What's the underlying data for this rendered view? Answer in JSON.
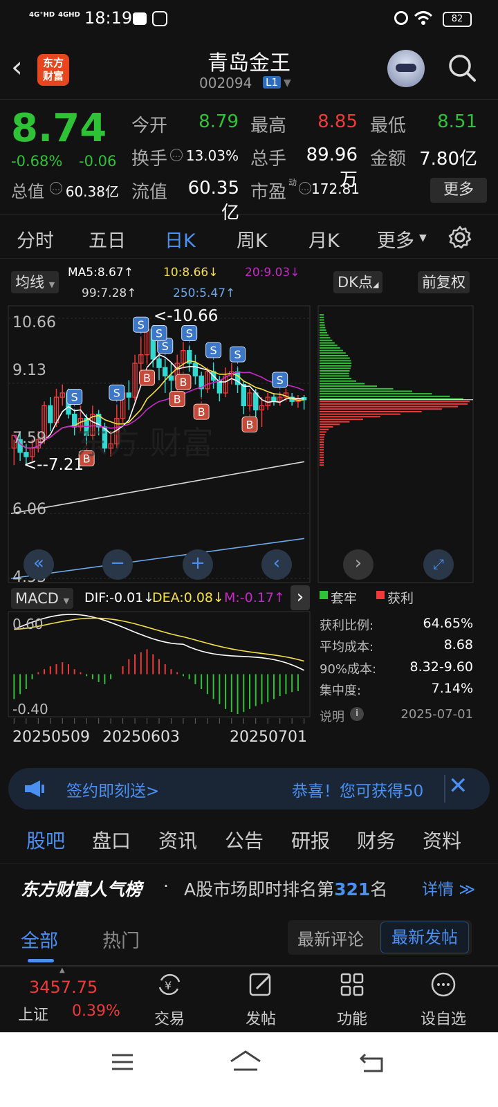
{
  "status_bar": {
    "net1": "4G⁺HD",
    "net2": "4GHD",
    "time": "18:19",
    "battery": "82"
  },
  "header": {
    "logo": "东方\n财富",
    "title": "青岛金王",
    "code": "002094",
    "level": "L1"
  },
  "quote": {
    "price": "8.74",
    "change_pct": "-0.68%",
    "change": "-0.06",
    "open_label": "今开",
    "open": "8.79",
    "high_label": "最高",
    "high": "8.85",
    "low_label": "最低",
    "low": "8.51",
    "turnover_label": "换手",
    "turnover": "13.03%",
    "volume_label": "总手",
    "volume": "89.96万",
    "amount_label": "金额",
    "amount": "7.80亿",
    "mktcap_label": "总值",
    "mktcap": "60.38亿",
    "float_label": "流值",
    "float": "60.35亿",
    "pe_label": "市盈",
    "pe_sup": "动",
    "pe": "172.81",
    "more": "更多"
  },
  "tabs": [
    {
      "label": "分时"
    },
    {
      "label": "五日"
    },
    {
      "label": "日K"
    },
    {
      "label": "周K"
    },
    {
      "label": "月K"
    },
    {
      "label": "更多"
    }
  ],
  "chart_controls": {
    "ma_select": "均线",
    "ma5": "MA5:8.67↑",
    "ma10": "10:8.66↓",
    "ma20": "20:9.03↓",
    "ma99": "99:7.28↑",
    "ma250": "250:5.47↑",
    "dk": "DK点",
    "fq": "前复权"
  },
  "chart_data": {
    "type": "candlestick",
    "y_ticks": [
      "10.66",
      "9.13",
      "7.59",
      "6.06",
      "4.53"
    ],
    "ylim": [
      4.53,
      10.66
    ],
    "annotations": [
      "<-10.66",
      "<--7.21"
    ],
    "signals": [
      "S",
      "B"
    ],
    "candles": [
      [
        7.6,
        7.9,
        7.2,
        7.8
      ],
      [
        7.8,
        7.5,
        7.3,
        8.0
      ],
      [
        7.5,
        7.4,
        7.21,
        7.7
      ],
      [
        7.4,
        7.6,
        7.3,
        7.8
      ],
      [
        7.6,
        7.8,
        7.5,
        8.0
      ],
      [
        7.8,
        8.6,
        7.7,
        8.7
      ],
      [
        8.6,
        8.2,
        8.0,
        8.8
      ],
      [
        8.2,
        8.8,
        8.1,
        9.0
      ],
      [
        8.8,
        8.9,
        8.6,
        9.1
      ],
      [
        8.9,
        8.4,
        8.3,
        9.0
      ],
      [
        8.4,
        8.1,
        7.9,
        8.5
      ],
      [
        8.1,
        8.3,
        8.0,
        8.6
      ],
      [
        8.3,
        7.9,
        7.7,
        8.4
      ],
      [
        7.9,
        8.4,
        7.8,
        8.6
      ],
      [
        8.4,
        8.1,
        7.9,
        8.5
      ],
      [
        8.1,
        7.6,
        7.5,
        8.2
      ],
      [
        7.6,
        7.7,
        7.4,
        8.0
      ],
      [
        7.7,
        8.3,
        7.6,
        8.6
      ],
      [
        8.3,
        8.9,
        8.2,
        9.0
      ],
      [
        8.9,
        8.8,
        8.5,
        9.2
      ],
      [
        8.8,
        9.6,
        8.7,
        9.8
      ],
      [
        9.6,
        9.8,
        9.3,
        10.2
      ],
      [
        9.8,
        10.4,
        9.6,
        10.66
      ],
      [
        10.4,
        9.7,
        9.5,
        10.5
      ],
      [
        9.7,
        9.5,
        9.2,
        10.0
      ],
      [
        9.5,
        9.3,
        8.9,
        9.7
      ],
      [
        9.3,
        9.2,
        8.9,
        9.6
      ],
      [
        9.2,
        9.6,
        9.1,
        9.8
      ],
      [
        9.6,
        9.9,
        9.5,
        10.1
      ],
      [
        9.9,
        9.6,
        9.4,
        10.0
      ],
      [
        9.6,
        9.3,
        9.1,
        9.8
      ],
      [
        9.3,
        9.0,
        8.8,
        9.4
      ],
      [
        9.0,
        9.4,
        8.9,
        9.5
      ],
      [
        9.4,
        9.2,
        9.0,
        9.6
      ],
      [
        9.2,
        8.9,
        8.7,
        9.3
      ],
      [
        8.9,
        9.3,
        8.8,
        9.5
      ],
      [
        9.3,
        9.4,
        9.1,
        9.6
      ],
      [
        9.4,
        9.1,
        8.9,
        9.5
      ],
      [
        9.1,
        8.6,
        8.4,
        9.2
      ],
      [
        8.6,
        8.9,
        8.5,
        9.0
      ],
      [
        8.9,
        8.5,
        8.3,
        9.0
      ],
      [
        8.5,
        8.6,
        8.1,
        8.8
      ],
      [
        8.6,
        8.8,
        8.5,
        8.9
      ],
      [
        8.8,
        8.7,
        8.6,
        8.9
      ],
      [
        8.7,
        8.8,
        8.6,
        8.9
      ],
      [
        8.8,
        8.9,
        8.7,
        9.0
      ],
      [
        8.8,
        8.7,
        8.6,
        8.9
      ],
      [
        8.7,
        8.75,
        8.55,
        8.85
      ],
      [
        8.79,
        8.74,
        8.51,
        8.85
      ]
    ],
    "ma250": [
      [
        0,
        6.06
      ],
      [
        1,
        6.45
      ]
    ],
    "macd": {
      "indicator": "MACD",
      "dif": "DIF:-0.01↓",
      "dea": "DEA:0.08↓",
      "m": "M:-0.17↑",
      "y_ticks": [
        "0.60",
        "-0.40"
      ],
      "hist": [
        -0.25,
        -0.2,
        -0.15,
        -0.05,
        0.02,
        0.05,
        0.08,
        0.1,
        0.12,
        0.1,
        0.05,
        0.02,
        -0.02,
        -0.05,
        -0.08,
        -0.1,
        -0.05,
        0.0,
        0.08,
        0.15,
        0.2,
        0.22,
        0.25,
        0.2,
        0.15,
        0.1,
        0.05,
        0.02,
        -0.02,
        -0.05,
        -0.1,
        -0.15,
        -0.2,
        -0.25,
        -0.3,
        -0.35,
        -0.38,
        -0.4,
        -0.38,
        -0.35,
        -0.32,
        -0.3,
        -0.28,
        -0.25,
        -0.22,
        -0.2,
        -0.18,
        -0.17
      ]
    },
    "x_ticks": [
      "20250509",
      "20250603",
      "20250701"
    ]
  },
  "chip": {
    "legend_trapped": "套牢",
    "legend_profit": "获利",
    "rows": [
      {
        "label": "获利比例:",
        "value": "64.65%"
      },
      {
        "label": "平均成本:",
        "value": "8.68"
      },
      {
        "label": "90%成本:",
        "value": "8.32-9.60"
      },
      {
        "label": "集中度:",
        "value": "7.14%"
      }
    ],
    "note": "说明",
    "date": "2025-07-01"
  },
  "banner": {
    "left": "签约即刻送>",
    "right": "恭喜！您可获得50"
  },
  "news_tabs": [
    {
      "label": "股吧"
    },
    {
      "label": "盘口"
    },
    {
      "label": "资讯"
    },
    {
      "label": "公告"
    },
    {
      "label": "研报"
    },
    {
      "label": "财务"
    },
    {
      "label": "资料"
    }
  ],
  "rank": {
    "brand": "东方财富人气榜",
    "dot": "·",
    "text_pre": "A股市场即时排名第",
    "rank": "321",
    "text_post": "名",
    "detail": "详情"
  },
  "filter": {
    "all": "全部",
    "hot": "热门",
    "latest_comment": "最新评论",
    "latest_post": "最新发帖"
  },
  "bottom_nav": {
    "index_value": "3457.75",
    "index_name": "上证",
    "index_change": "0.39%",
    "items": [
      {
        "label": "交易"
      },
      {
        "label": "发帖"
      },
      {
        "label": "功能"
      },
      {
        "label": "设自选"
      }
    ]
  },
  "colors": {
    "up": "#f03a3a",
    "down": "#2fc236",
    "accent": "#4b8ff0",
    "ma5": "#ffffff",
    "ma10": "#f5e04a",
    "ma20": "#c629c6",
    "ma99": "#d9d9d9",
    "ma250": "#6fa8e8"
  }
}
